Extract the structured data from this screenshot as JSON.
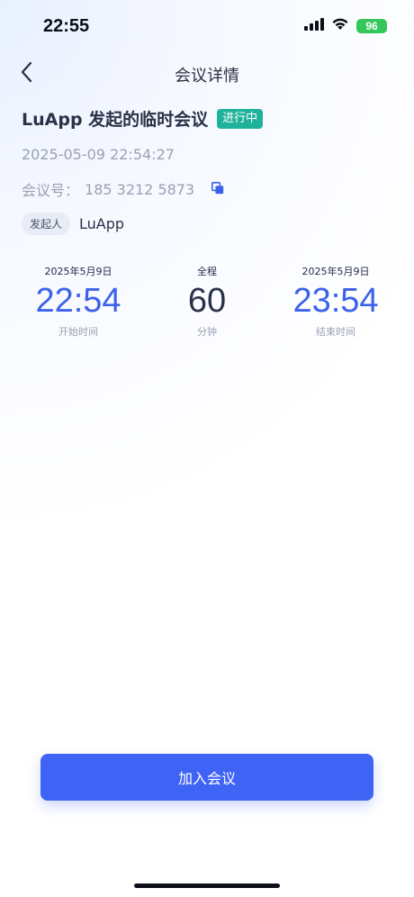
{
  "status_bar": {
    "time": "22:55",
    "battery": "96"
  },
  "header": {
    "title": "会议详情"
  },
  "meeting": {
    "title": "LuApp 发起的临时会议",
    "status": "进行中",
    "created_at": "2025-05-09 22:54:27",
    "id_label": "会议号：",
    "id_value": "185 3212 5873",
    "initiator_tag": "发起人",
    "initiator_name": "LuApp"
  },
  "schedule": {
    "start": {
      "date": "2025年5月9日",
      "time": "22:54",
      "caption": "开始时间"
    },
    "duration": {
      "label": "全程",
      "value": "60",
      "unit": "分钟"
    },
    "end": {
      "date": "2025年5月9日",
      "time": "23:54",
      "caption": "结束时间"
    }
  },
  "actions": {
    "join_label": "加入会议"
  },
  "colors": {
    "accent": "#3f63f5",
    "time_blue": "#3c62ea",
    "status_green": "#1fb29b",
    "battery_green": "#34c759"
  },
  "icons": {
    "back": "chevron-left-icon",
    "copy": "copy-icon",
    "signal": "cellular-signal-icon",
    "wifi": "wifi-icon"
  }
}
